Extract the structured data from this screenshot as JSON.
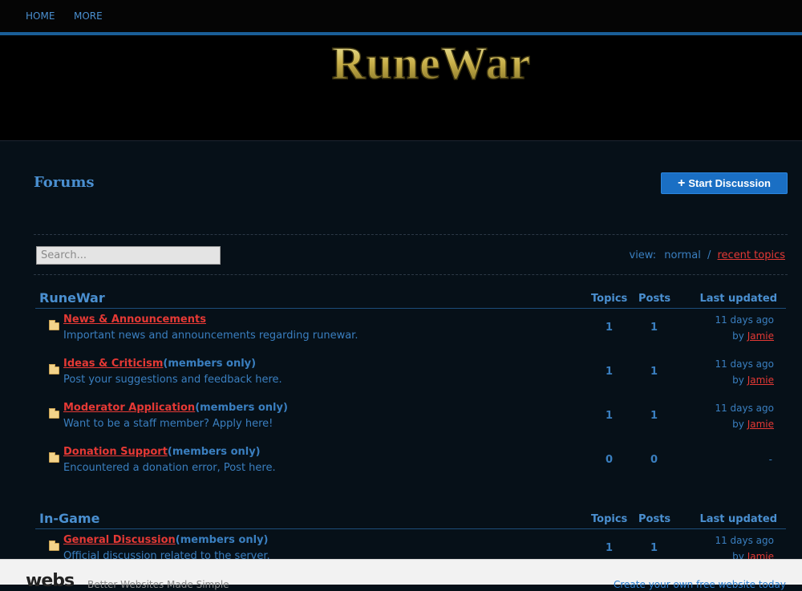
{
  "nav": {
    "items": [
      {
        "label": "HOME"
      },
      {
        "label": "MORE"
      }
    ]
  },
  "header": {
    "logo_text": "RuneWar"
  },
  "page": {
    "title": "Forums",
    "start_button": "Start Discussion"
  },
  "search": {
    "placeholder": "Search..."
  },
  "view": {
    "label": "view:",
    "normal": "normal",
    "separator": "/",
    "recent": "recent topics"
  },
  "columns": {
    "topics": "Topics",
    "posts": "Posts",
    "last_updated": "Last updated"
  },
  "categories": [
    {
      "name": "RuneWar",
      "forums": [
        {
          "title": "News & Announcements",
          "note": "",
          "desc": "Important news and announcements regarding runewar.",
          "topics": "1",
          "posts": "1",
          "when": "11 days ago",
          "by": "by",
          "user": "Jamie"
        },
        {
          "title": "Ideas & Criticism",
          "note": "(members only)",
          "desc": "Post your suggestions and feedback here.",
          "topics": "1",
          "posts": "1",
          "when": "11 days ago",
          "by": "by",
          "user": "Jamie"
        },
        {
          "title": "Moderator Application",
          "note": "(members only)",
          "desc": "Want to be a staff member? Apply here!",
          "topics": "1",
          "posts": "1",
          "when": "11 days ago",
          "by": "by",
          "user": "Jamie"
        },
        {
          "title": "Donation Support",
          "note": "(members only)",
          "desc": "Encountered a donation error, Post here.",
          "topics": "0",
          "posts": "0",
          "when": "",
          "by": "",
          "user": "",
          "empty": "-"
        }
      ]
    },
    {
      "name": "In-Game",
      "forums": [
        {
          "title": "General Discussion",
          "note": "(members only)",
          "desc": "Official discussion related to the server.",
          "topics": "1",
          "posts": "1",
          "when": "11 days ago",
          "by": "by",
          "user": "Jamie"
        }
      ]
    }
  ],
  "footer": {
    "logo": "webs",
    "tagline": "Better Websites Made Simple",
    "cta": "Create your own free website today"
  },
  "colors": {
    "accent": "#3a7fc0",
    "link": "#e53935",
    "button": "#1a6fc4"
  }
}
